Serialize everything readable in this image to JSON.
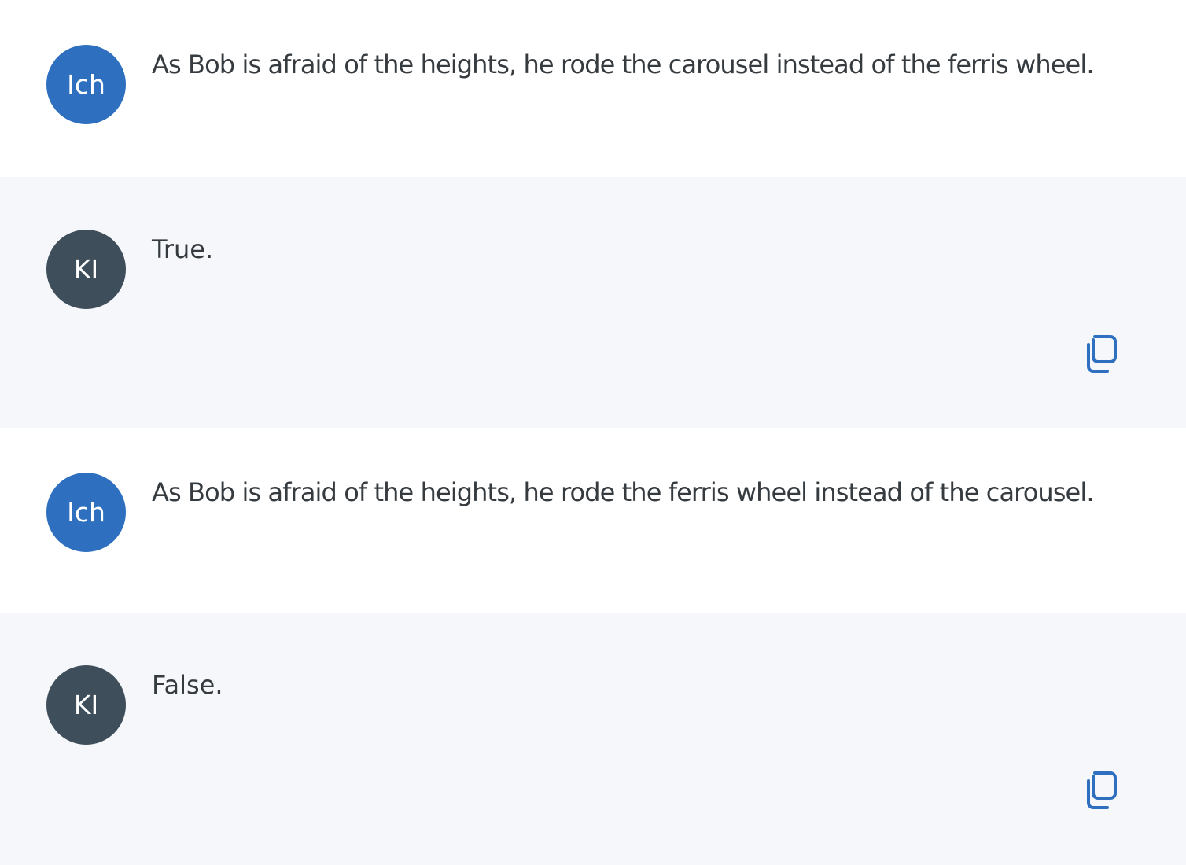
{
  "conversation": {
    "messages": [
      {
        "role": "user",
        "avatar_label": "Ich",
        "text": "As Bob is afraid of the heights, he rode the carousel instead of the ferris wheel."
      },
      {
        "role": "assistant",
        "avatar_label": "KI",
        "text": "True.",
        "action_icon": "copy-icon"
      },
      {
        "role": "user",
        "avatar_label": "Ich",
        "text": "As Bob is afraid of the heights, he rode the ferris wheel instead of the carousel."
      },
      {
        "role": "assistant",
        "avatar_label": "KI",
        "text": "False.",
        "action_icon": "copy-icon"
      }
    ]
  },
  "colors": {
    "user_avatar": "#2e70bf",
    "ai_avatar": "#3e4e5a",
    "ai_background": "#f5f7fb",
    "user_background": "#ffffff",
    "copy_icon": "#2e70bf",
    "text": "#363b40"
  }
}
